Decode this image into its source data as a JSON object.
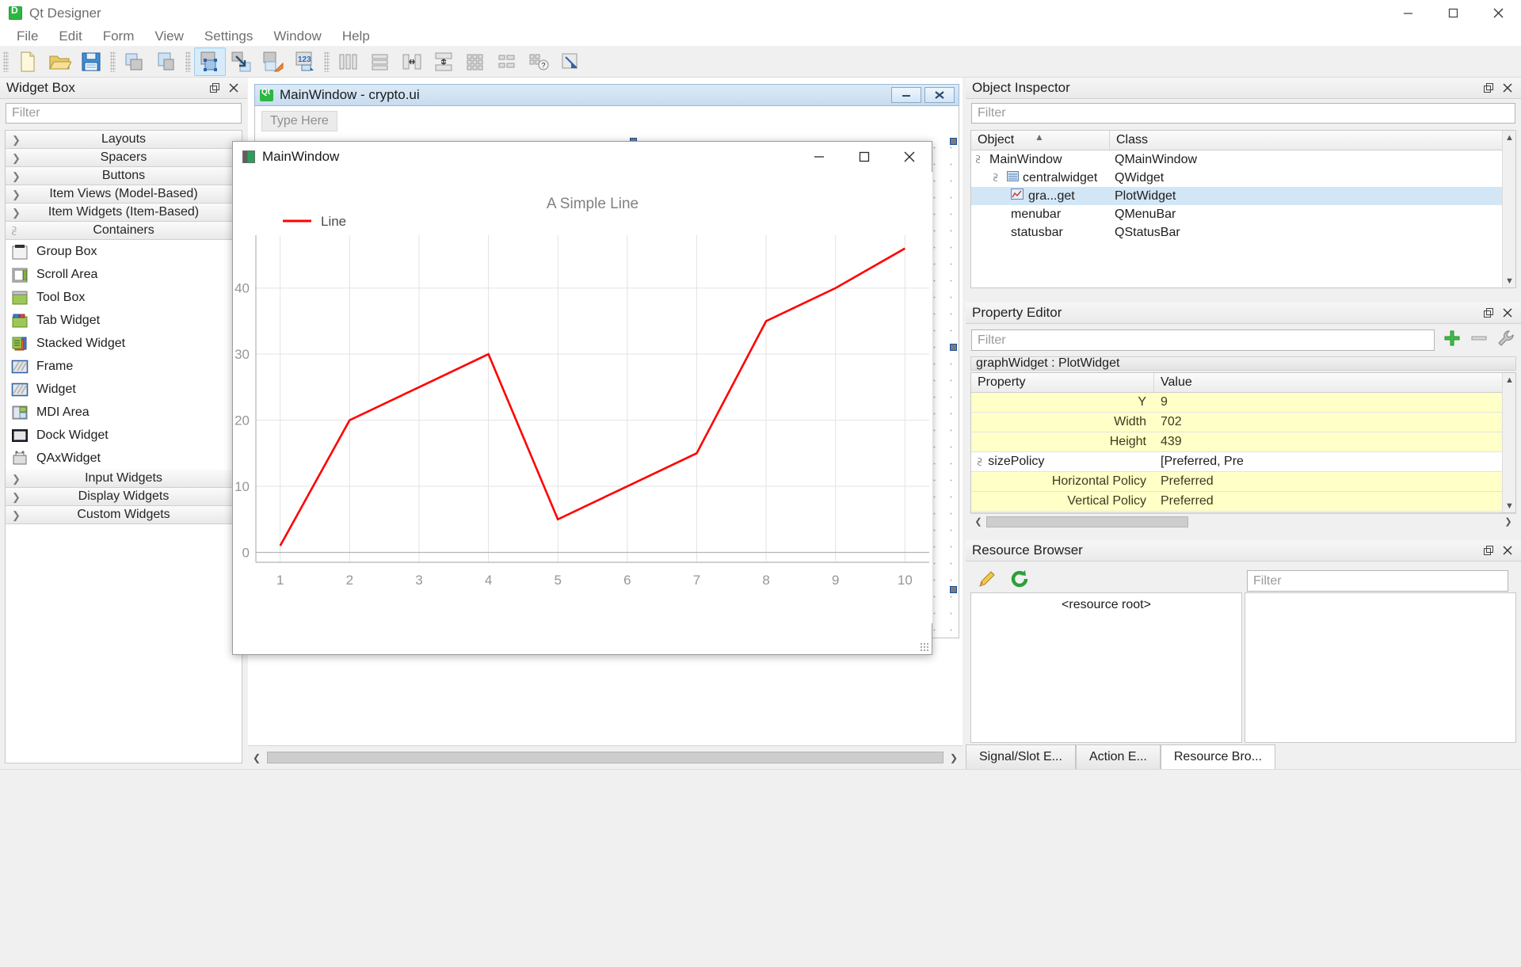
{
  "window": {
    "title": "Qt Designer",
    "app_icon": "qt-designer-icon",
    "minimize": "minimize-icon",
    "maximize": "maximize-icon",
    "close": "close-icon"
  },
  "menu": {
    "items": [
      "File",
      "Edit",
      "Form",
      "View",
      "Settings",
      "Window",
      "Help"
    ]
  },
  "toolbar": {
    "groups": [
      {
        "buttons": [
          {
            "name": "new-form-button",
            "icon": "new-document-icon"
          },
          {
            "name": "open-form-button",
            "icon": "open-folder-icon"
          },
          {
            "name": "save-form-button",
            "icon": "floppy-save-icon"
          }
        ]
      },
      {
        "buttons": [
          {
            "name": "undo-button",
            "icon": "undo-pages-icon"
          },
          {
            "name": "redo-button",
            "icon": "redo-pages-icon"
          }
        ]
      },
      {
        "buttons": [
          {
            "name": "edit-widgets-button",
            "icon": "edit-widgets-icon",
            "active": true
          },
          {
            "name": "edit-signals-slots-button",
            "icon": "signals-slots-icon"
          },
          {
            "name": "edit-buddies-button",
            "icon": "buddies-tag-icon"
          },
          {
            "name": "edit-tab-order-button",
            "icon": "tab-order-123-icon"
          }
        ]
      },
      {
        "buttons": [
          {
            "name": "layout-horizontally-button",
            "icon": "layout-horizontal-icon"
          },
          {
            "name": "layout-vertically-button",
            "icon": "layout-vertical-icon"
          },
          {
            "name": "layout-splitter-horizontal-button",
            "icon": "splitter-horizontal-icon"
          },
          {
            "name": "layout-splitter-vertical-button",
            "icon": "splitter-vertical-icon"
          },
          {
            "name": "layout-grid-button",
            "icon": "layout-grid-icon"
          },
          {
            "name": "layout-form-button",
            "icon": "layout-form-icon"
          },
          {
            "name": "break-layout-button",
            "icon": "break-layout-icon"
          },
          {
            "name": "adjust-size-button",
            "icon": "adjust-size-icon"
          }
        ]
      }
    ]
  },
  "widget_box": {
    "title": "Widget Box",
    "float_icon": "undock-icon",
    "close_icon": "close-icon",
    "filter_placeholder": "Filter",
    "categories": [
      {
        "label": "Layouts",
        "expanded": false
      },
      {
        "label": "Spacers",
        "expanded": false
      },
      {
        "label": "Buttons",
        "expanded": false
      },
      {
        "label": "Item Views (Model-Based)",
        "expanded": false
      },
      {
        "label": "Item Widgets (Item-Based)",
        "expanded": false
      },
      {
        "label": "Containers",
        "expanded": true
      }
    ],
    "container_items": [
      {
        "label": "Group Box",
        "icon": "group-box-icon"
      },
      {
        "label": "Scroll Area",
        "icon": "scroll-area-icon"
      },
      {
        "label": "Tool Box",
        "icon": "tool-box-icon"
      },
      {
        "label": "Tab Widget",
        "icon": "tab-widget-icon"
      },
      {
        "label": "Stacked Widget",
        "icon": "stacked-widget-icon"
      },
      {
        "label": "Frame",
        "icon": "frame-icon"
      },
      {
        "label": "Widget",
        "icon": "widget-icon"
      },
      {
        "label": "MDI Area",
        "icon": "mdi-area-icon"
      },
      {
        "label": "Dock Widget",
        "icon": "dock-widget-icon"
      },
      {
        "label": "QAxWidget",
        "icon": "qax-widget-icon"
      }
    ],
    "trailing_categories": [
      {
        "label": "Input Widgets",
        "expanded": false
      },
      {
        "label": "Display Widgets",
        "expanded": false
      },
      {
        "label": "Custom Widgets",
        "expanded": false
      }
    ]
  },
  "form_window": {
    "title": "MainWindow - crypto.ui",
    "icon": "qt-form-icon",
    "minimize": "minimize-icon",
    "close": "close-icon",
    "menu_placeholder": "Type Here"
  },
  "preview_window": {
    "title": "MainWindow",
    "icon": "app-window-icon",
    "minimize": "minimize-icon",
    "maximize": "maximize-icon",
    "close": "close-icon"
  },
  "chart_data": {
    "type": "line",
    "title": "A Simple Line",
    "xlabel": "",
    "ylabel": "",
    "x": [
      1,
      2,
      3,
      4,
      5,
      6,
      7,
      8,
      9,
      10
    ],
    "series": [
      {
        "name": "Line",
        "color": "#ff0000",
        "values": [
          1,
          20,
          25,
          30,
          5,
          10,
          15,
          35,
          40,
          46
        ]
      }
    ],
    "xlim": [
      0.65,
      10.35
    ],
    "ylim": [
      -1.5,
      48
    ],
    "xticks": [
      1,
      2,
      3,
      4,
      5,
      6,
      7,
      8,
      9,
      10
    ],
    "yticks": [
      0,
      10,
      20,
      30,
      40
    ],
    "grid": true,
    "legend": {
      "position": "top-left",
      "entries": [
        "Line"
      ]
    },
    "title_color": "#808080",
    "tick_color": "#969696",
    "grid_color": "#e3e3e3"
  },
  "object_inspector": {
    "title": "Object Inspector",
    "float_icon": "undock-icon",
    "close_icon": "close-icon",
    "filter_placeholder": "Filter",
    "columns": [
      "Object",
      "Class"
    ],
    "sort_indicator": "sort-asc-icon",
    "rows": [
      {
        "object": "MainWindow",
        "class": "QMainWindow",
        "indent": 0,
        "expander": "chevron-down",
        "icon": "",
        "selected": false
      },
      {
        "object": "centralwidget",
        "class": "QWidget",
        "indent": 1,
        "expander": "chevron-down",
        "icon": "widget-tree-icon",
        "selected": false
      },
      {
        "object": "gra...get",
        "class": "PlotWidget",
        "indent": 2,
        "expander": "",
        "icon": "plot-widget-icon",
        "selected": true
      },
      {
        "object": "menubar",
        "class": "QMenuBar",
        "indent": 1,
        "expander": "",
        "icon": "",
        "selected": false
      },
      {
        "object": "statusbar",
        "class": "QStatusBar",
        "indent": 1,
        "expander": "",
        "icon": "",
        "selected": false
      }
    ]
  },
  "property_editor": {
    "title": "Property Editor",
    "float_icon": "undock-icon",
    "close_icon": "close-icon",
    "filter_placeholder": "Filter",
    "add_icon": "plus-green-icon",
    "remove_icon": "minus-gray-icon",
    "configure_icon": "wrench-icon",
    "object_label": "graphWidget : PlotWidget",
    "columns": [
      "Property",
      "Value"
    ],
    "rows": [
      {
        "name": "Y",
        "value": "9",
        "highlight": true,
        "indent": 1,
        "expander": ""
      },
      {
        "name": "Width",
        "value": "702",
        "highlight": true,
        "indent": 1,
        "expander": ""
      },
      {
        "name": "Height",
        "value": "439",
        "highlight": true,
        "indent": 1,
        "expander": ""
      },
      {
        "name": "sizePolicy",
        "value": "[Preferred, Pre",
        "highlight": false,
        "indent": 0,
        "expander": "chevron-down"
      },
      {
        "name": "Horizontal Policy",
        "value": "Preferred",
        "highlight": true,
        "indent": 1,
        "expander": ""
      },
      {
        "name": "Vertical Policy",
        "value": "Preferred",
        "highlight": true,
        "indent": 1,
        "expander": ""
      }
    ]
  },
  "resource_browser": {
    "title": "Resource Browser",
    "float_icon": "undock-icon",
    "close_icon": "close-icon",
    "edit_icon": "pencil-edit-icon",
    "reload_icon": "reload-green-icon",
    "filter_placeholder": "Filter",
    "root_label": "<resource root>"
  },
  "bottom_tabs": [
    {
      "label": "Signal/Slot E...",
      "active": false
    },
    {
      "label": "Action E...",
      "active": false
    },
    {
      "label": "Resource Bro...",
      "active": true
    }
  ]
}
